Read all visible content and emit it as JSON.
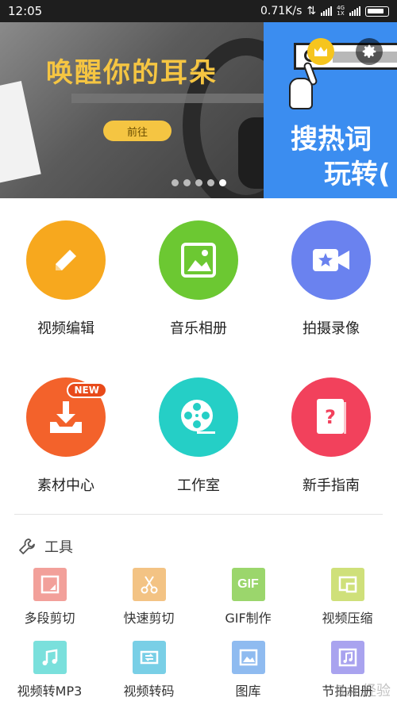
{
  "status_bar": {
    "time": "12:05",
    "speed": "0.71K/s"
  },
  "banner": {
    "title": "唤醒你的耳朵",
    "cta": "前往",
    "right_line1": "搜热词",
    "right_line2": "玩转(",
    "page_count": 5,
    "active_page": 5
  },
  "features": [
    {
      "label": "视频编辑",
      "color": "#f7a81e"
    },
    {
      "label": "音乐相册",
      "color": "#6cc832"
    },
    {
      "label": "拍摄录像",
      "color": "#6a82ef"
    },
    {
      "label": "素材中心",
      "color": "#f3622b",
      "badge": "NEW"
    },
    {
      "label": "工作室",
      "color": "#25cfc6"
    },
    {
      "label": "新手指南",
      "color": "#f2415c"
    }
  ],
  "tools": {
    "header": "工具",
    "items": [
      {
        "label": "多段剪切",
        "color": "#f2a09a"
      },
      {
        "label": "快速剪切",
        "color": "#f3c384"
      },
      {
        "label": "GIF制作",
        "color": "#9bd66c",
        "icon_text": "GIF"
      },
      {
        "label": "视频压缩",
        "color": "#cfe07a"
      },
      {
        "label": "视频转MP3",
        "color": "#7ae0dc"
      },
      {
        "label": "视频转码",
        "color": "#79cfe6"
      },
      {
        "label": "图库",
        "color": "#8fbbf0"
      },
      {
        "label": "节拍相册",
        "color": "#a9a3ef"
      }
    ]
  },
  "watermark": "Bai 经验"
}
